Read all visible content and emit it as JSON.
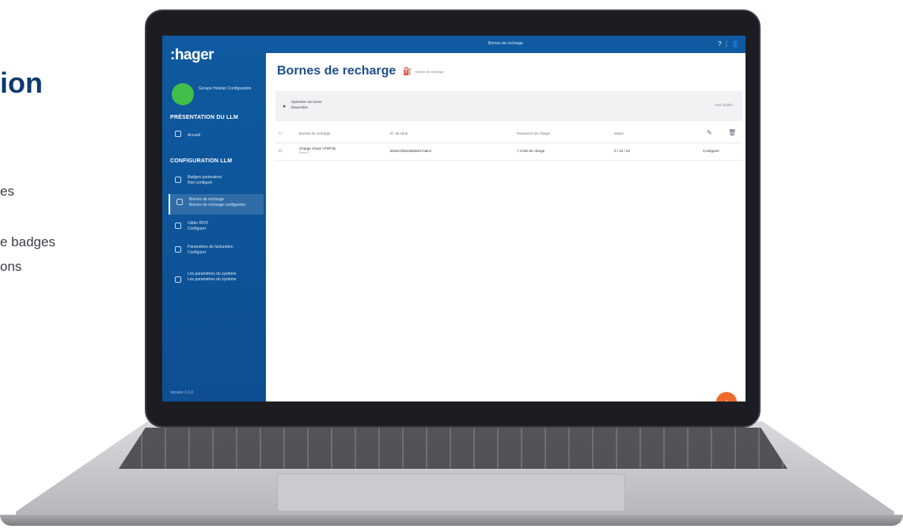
{
  "marketing": {
    "title_fragment": "ion",
    "lines": [
      "es",
      "e badges",
      "ons"
    ]
  },
  "app": {
    "logo": ":hager",
    "topbar_title": "Bornes de recharge",
    "topbar_icons": "?  ⋮  👤",
    "colors": {
      "sidebar": "#0f5aa0",
      "accent": "#f06a2a",
      "title": "#1e4f8c",
      "avatar": "#3fbf4a"
    }
  },
  "sidebar": {
    "user_name": "Groupe Hotelier Configuration",
    "section_presentation": "PRÉSENTATION DU LLM",
    "presentation_item": "Accueil",
    "section_configuration": "CONFIGURATION LLM",
    "items": [
      {
        "label": "Badges partenaires",
        "sub": "Non configuré",
        "icon": "user-icon"
      },
      {
        "label": "Bornes de recharge",
        "sub": "Bornes de recharge configurées",
        "icon": "charger-icon"
      },
      {
        "label": "Câble RFID",
        "sub": "Configurer",
        "icon": "shield-icon"
      },
      {
        "label": "Paramètres de facturation",
        "sub": "Configurer",
        "icon": "user-icon"
      },
      {
        "label": "Les paramètres du système",
        "sub": "Les paramètres du système",
        "icon": "user-icon"
      }
    ],
    "version": "Version 1.0.0"
  },
  "main": {
    "page_title": "Bornes de recharge",
    "title_subtitle": "Bornes de recharge",
    "panel": {
      "label": "Opération de borne",
      "sub": "Disponible",
      "action": "Tout déplier"
    },
    "table": {
      "headers": [
        "Bornes de recharge",
        "N° de série",
        "Puissance de charge",
        "Statut"
      ],
      "rows": [
        {
          "name": "Charge chose VTRF35",
          "name_sub": "Borne 1",
          "serial": "8046c2f4b2a9d3ef17a6c2",
          "power": "7.4 kW de charge",
          "status": "0 / 22 / 22",
          "action": "Configurer"
        }
      ]
    },
    "fab_label": "+"
  }
}
